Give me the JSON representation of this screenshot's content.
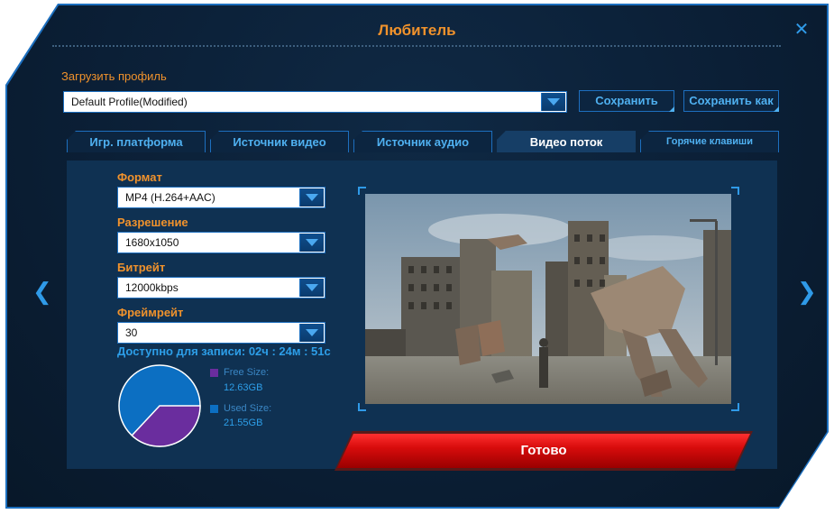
{
  "window": {
    "title": "Любитель",
    "close_glyph": "✕"
  },
  "profile": {
    "label": "Загрузить профиль",
    "selected": "Default Profile(Modified)",
    "save_label": "Сохранить",
    "save_as_label": "Сохранить как"
  },
  "tabs": [
    {
      "label": "Игр. платформа",
      "active": false
    },
    {
      "label": "Источник видео",
      "active": false
    },
    {
      "label": "Источник аудио",
      "active": false
    },
    {
      "label": "Видео поток",
      "active": true
    },
    {
      "label": "Горячие клавиши",
      "active": false
    }
  ],
  "settings": {
    "format": {
      "label": "Формат",
      "value": "MP4 (H.264+AAC)"
    },
    "resolution": {
      "label": "Разрешение",
      "value": "1680x1050"
    },
    "bitrate": {
      "label": "Битрейт",
      "value": "12000kbps"
    },
    "framerate": {
      "label": "Фреймрейт",
      "value": "30"
    }
  },
  "storage": {
    "available_text": "Доступно для записи: 02ч : 24м : 51с",
    "free_label": "Free Size:",
    "free_value": "12.63GB",
    "used_label": "Used Size:",
    "used_value": "21.55GB",
    "free_gb": 12.63,
    "used_gb": 21.55,
    "free_color": "#6a2d9e",
    "used_color": "#0c6fc2"
  },
  "preview": {
    "icon": "game-preview-image"
  },
  "done_label": "Готово",
  "nav": {
    "prev_glyph": "❮",
    "next_glyph": "❯"
  },
  "colors": {
    "accent_orange": "#f0922c",
    "accent_blue": "#2f9ae8",
    "done_red": "#d80c0c"
  }
}
